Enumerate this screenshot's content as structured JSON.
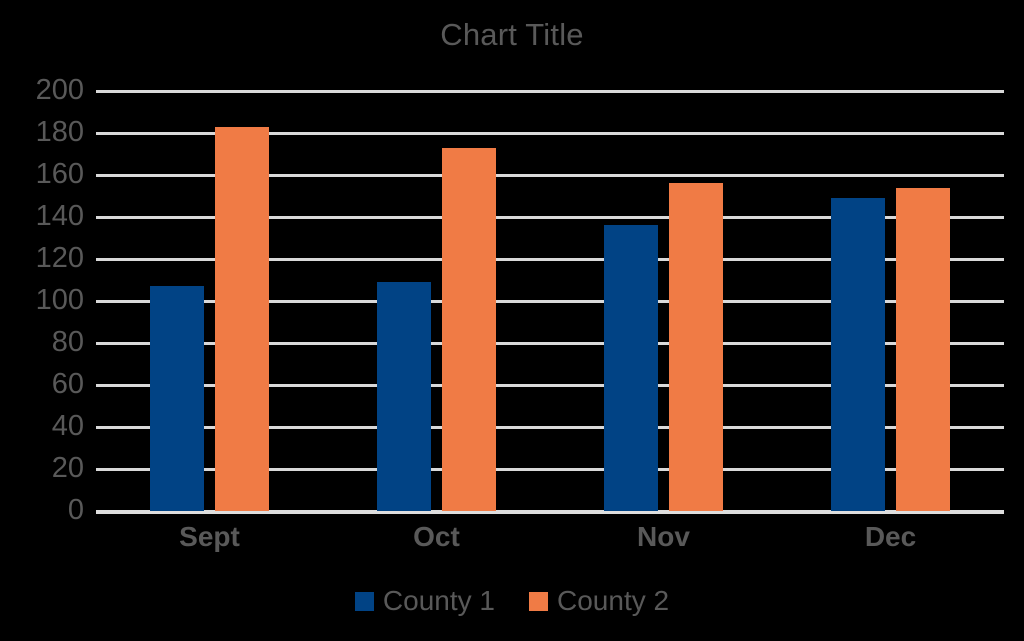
{
  "chart_data": {
    "type": "bar",
    "title": "Chart Title",
    "xlabel": "",
    "ylabel": "",
    "categories": [
      "Sept",
      "Oct",
      "Nov",
      "Dec"
    ],
    "series": [
      {
        "name": "County 1",
        "color": "#014385",
        "values": [
          107,
          109,
          136,
          149
        ]
      },
      {
        "name": "County 2",
        "color": "#F07B45",
        "values": [
          183,
          173,
          156,
          154
        ]
      }
    ],
    "ylim": [
      0,
      200
    ],
    "ytick_labels": [
      "200",
      "180",
      "160",
      "140",
      "120",
      "100",
      "80",
      "60",
      "40",
      "20",
      "0"
    ],
    "ytick_values": [
      200,
      180,
      160,
      140,
      120,
      100,
      80,
      60,
      40,
      20,
      0
    ],
    "grid": true,
    "grid_axis": "y",
    "legend_position": "bottom",
    "background_color": "#000000",
    "text_color": "#595959",
    "gridline_color": "#D9D9D9"
  }
}
